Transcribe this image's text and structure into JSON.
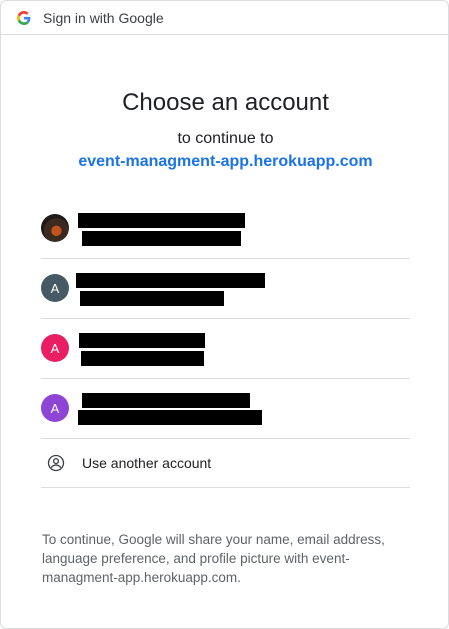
{
  "topbar": {
    "title": "Sign in with Google",
    "logo_icon": "google-g-icon"
  },
  "main": {
    "heading": "Choose an account",
    "subheading": "to continue to",
    "app_name": "event-managment-app.herokuapp.com"
  },
  "accounts": [
    {
      "avatar_type": "photo",
      "avatar_letter": "",
      "avatar_color": "#2b2420",
      "name_redacted": true,
      "email_redacted": true
    },
    {
      "avatar_type": "letter",
      "avatar_letter": "A",
      "avatar_color": "#455a64",
      "name_redacted": true,
      "email_redacted": true
    },
    {
      "avatar_type": "letter",
      "avatar_letter": "A",
      "avatar_color": "#e91e63",
      "name_redacted": true,
      "email_redacted": true
    },
    {
      "avatar_type": "letter",
      "avatar_letter": "A",
      "avatar_color": "#8e44d4",
      "name_redacted": true,
      "email_redacted": true
    }
  ],
  "another_account": {
    "label": "Use another account",
    "icon": "person-circle-icon"
  },
  "footer": {
    "note": "To continue, Google will share your name, email address, language preference, and profile picture with event-managment-app.herokuapp.com."
  },
  "colors": {
    "link_blue": "#1a73e8",
    "divider": "#dadce0",
    "muted_text": "#5f6368"
  }
}
